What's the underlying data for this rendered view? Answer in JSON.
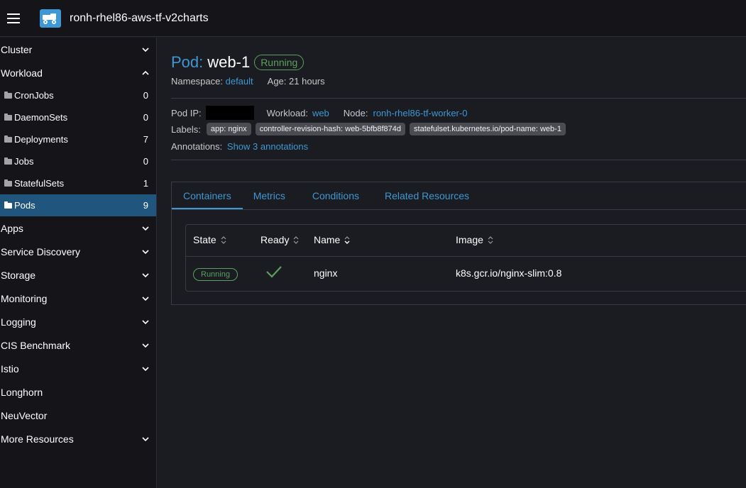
{
  "header": {
    "menu_icon": "hamburger-icon",
    "logo_icon": "cluster-logo-icon",
    "cluster_name": "ronh-rhel86-aws-tf-v2charts"
  },
  "sidebar": {
    "groups_top": [
      {
        "label": "Cluster",
        "expanded": false
      },
      {
        "label": "Workload",
        "expanded": true
      }
    ],
    "workload_items": [
      {
        "label": "CronJobs",
        "count": "0"
      },
      {
        "label": "DaemonSets",
        "count": "0"
      },
      {
        "label": "Deployments",
        "count": "7"
      },
      {
        "label": "Jobs",
        "count": "0"
      },
      {
        "label": "StatefulSets",
        "count": "1"
      },
      {
        "label": "Pods",
        "count": "9",
        "active": true
      }
    ],
    "groups_bottom": [
      {
        "label": "Apps",
        "expanded": false
      },
      {
        "label": "Service Discovery",
        "expanded": false
      },
      {
        "label": "Storage",
        "expanded": false
      },
      {
        "label": "Monitoring",
        "expanded": false
      },
      {
        "label": "Logging",
        "expanded": false
      },
      {
        "label": "CIS Benchmark",
        "expanded": false
      },
      {
        "label": "Istio",
        "expanded": false
      },
      {
        "label": "Longhorn"
      },
      {
        "label": "NeuVector"
      },
      {
        "label": "More Resources",
        "expanded": false
      }
    ]
  },
  "pod": {
    "kind": "Pod:",
    "name": "web-1",
    "status": "Running",
    "namespace_label": "Namespace:",
    "namespace": "default",
    "age_label": "Age:",
    "age": "21 hours",
    "pod_ip_label": "Pod IP:",
    "workload_label": "Workload:",
    "workload": "web",
    "node_label": "Node:",
    "node": "ronh-rhel86-tf-worker-0",
    "labels_label": "Labels:",
    "labels": [
      "app: nginx",
      "controller-revision-hash: web-5bfb8f874d",
      "statefulset.kubernetes.io/pod-name: web-1"
    ],
    "annotations_label": "Annotations:",
    "annotations_link": "Show 3 annotations"
  },
  "tabs": [
    {
      "label": "Containers",
      "active": true
    },
    {
      "label": "Metrics"
    },
    {
      "label": "Conditions"
    },
    {
      "label": "Related Resources"
    }
  ],
  "containers_table": {
    "columns": [
      "State",
      "Ready",
      "Name",
      "Image"
    ],
    "rows": [
      {
        "state": "Running",
        "ready": "check-icon",
        "name": "nginx",
        "image": "k8s.gcr.io/nginx-slim:0.8"
      }
    ]
  },
  "colors": {
    "accent": "#3d98d3",
    "running": "#5aa05f",
    "active_nav": "#20567d",
    "background": "#1b1c21"
  }
}
